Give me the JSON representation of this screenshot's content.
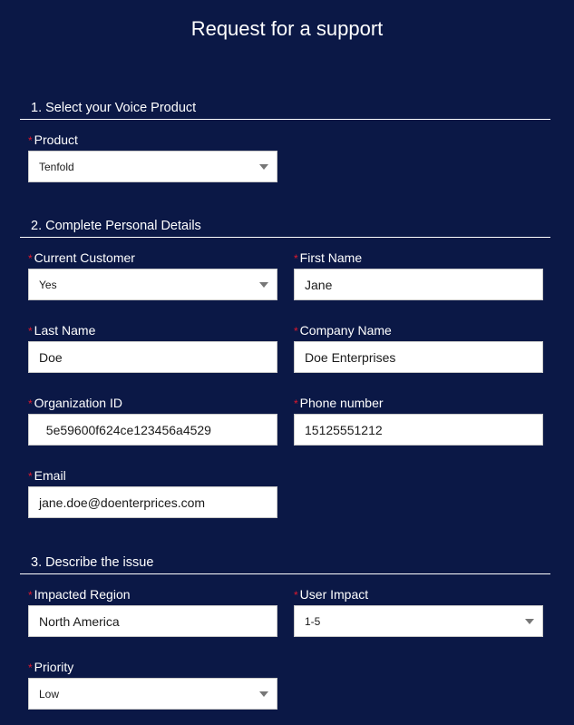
{
  "page": {
    "title": "Request for a support"
  },
  "colors": {
    "background": "#0b1846",
    "required": "#e0182d",
    "text": "#ffffff"
  },
  "sections": [
    {
      "heading": "1. Select your Voice Product"
    },
    {
      "heading": "2. Complete Personal Details"
    },
    {
      "heading": "3. Describe the issue"
    }
  ],
  "fields": {
    "product": {
      "label": "Product",
      "required_mark": "*",
      "value": "Tenfold",
      "type": "select"
    },
    "current_customer": {
      "label": "Current Customer",
      "required_mark": "*",
      "value": "Yes",
      "type": "select"
    },
    "first_name": {
      "label": "First Name",
      "required_mark": "*",
      "value": "Jane",
      "type": "input"
    },
    "last_name": {
      "label": "Last Name",
      "required_mark": "*",
      "value": "Doe",
      "type": "input"
    },
    "company_name": {
      "label": "Company Name",
      "required_mark": "*",
      "value": "Doe Enterprises",
      "type": "input"
    },
    "organization_id": {
      "label": "Organization ID",
      "required_mark": "*",
      "value": "  5e59600f624ce123456a4529",
      "type": "input"
    },
    "phone_number": {
      "label": "Phone number",
      "required_mark": "*",
      "value": "15125551212",
      "type": "input"
    },
    "email": {
      "label": "Email",
      "required_mark": "*",
      "value": "jane.doe@doenterprices.com",
      "type": "input"
    },
    "impacted_region": {
      "label": "Impacted Region",
      "required_mark": "*",
      "value": "North America",
      "type": "input"
    },
    "user_impact": {
      "label": "User Impact",
      "required_mark": "*",
      "value": "1-5",
      "type": "select"
    },
    "priority": {
      "label": "Priority",
      "required_mark": "*",
      "value": "Low",
      "type": "select"
    }
  }
}
